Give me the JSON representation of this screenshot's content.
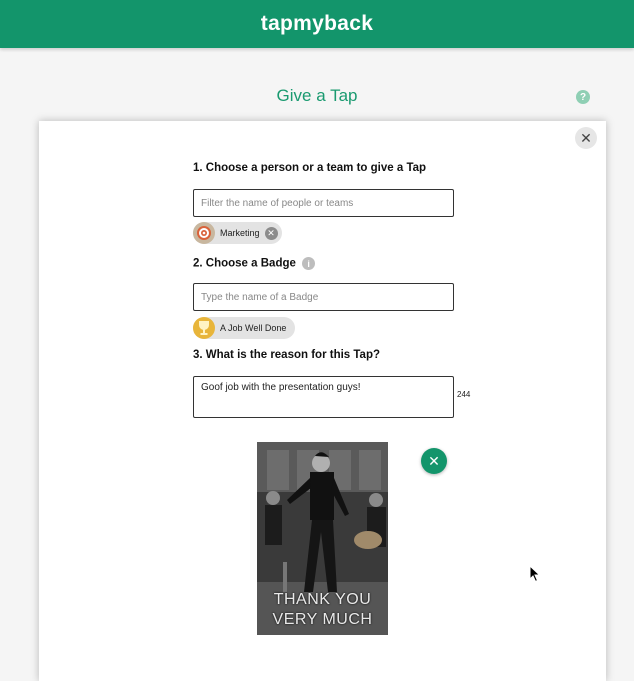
{
  "header": {
    "logo_text": "tapmyback",
    "brand_color": "#13956b"
  },
  "page": {
    "title": "Give a Tap",
    "help_icon": "question-icon"
  },
  "modal": {
    "close_icon": "close-icon",
    "step1": {
      "label": "1. Choose a person or a team to give a Tap",
      "placeholder": "Filter the name of people or teams",
      "selected": {
        "label": "Marketing",
        "icon": "target-icon"
      }
    },
    "step2": {
      "label": "2. Choose a Badge",
      "info_icon": "info-icon",
      "placeholder": "Type the name of a Badge",
      "selected": {
        "label": "A Job Well Done",
        "icon": "trophy-icon"
      }
    },
    "step3": {
      "label": "3. What is the reason for this Tap?",
      "value": "Goof job with the presentation guys!",
      "char_count": "244"
    },
    "gif": {
      "caption_line1": "THANK YOU",
      "caption_line2": "VERY MUCH",
      "remove_icon": "close-icon"
    }
  }
}
